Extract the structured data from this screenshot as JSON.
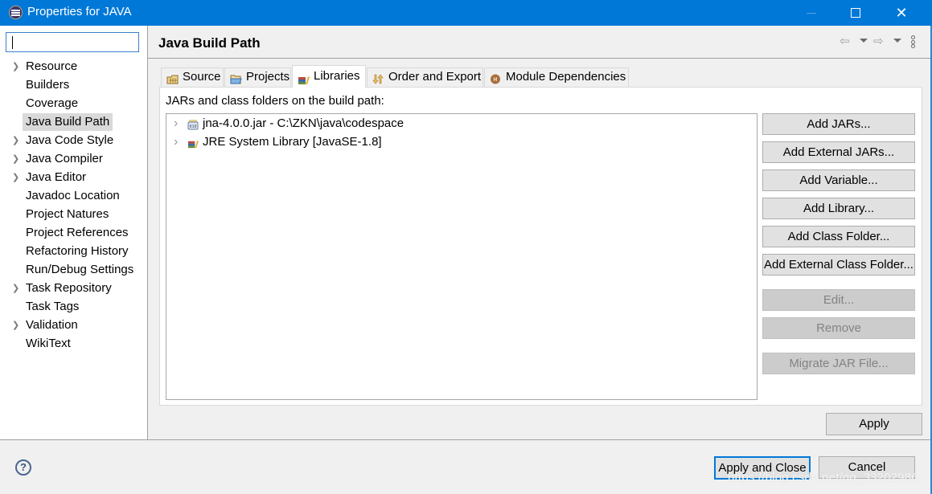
{
  "window": {
    "title": "Properties for JAVA",
    "controls": {
      "minimize": "minimize",
      "maximize": "maximize",
      "close": "✕"
    }
  },
  "sidebar": {
    "filter": {
      "value": "",
      "placeholder": ""
    },
    "items": [
      {
        "label": "Resource",
        "expandable": true,
        "selected": false
      },
      {
        "label": "Builders",
        "expandable": false,
        "selected": false
      },
      {
        "label": "Coverage",
        "expandable": false,
        "selected": false
      },
      {
        "label": "Java Build Path",
        "expandable": false,
        "selected": true
      },
      {
        "label": "Java Code Style",
        "expandable": true,
        "selected": false
      },
      {
        "label": "Java Compiler",
        "expandable": true,
        "selected": false
      },
      {
        "label": "Java Editor",
        "expandable": true,
        "selected": false
      },
      {
        "label": "Javadoc Location",
        "expandable": false,
        "selected": false
      },
      {
        "label": "Project Natures",
        "expandable": false,
        "selected": false
      },
      {
        "label": "Project References",
        "expandable": false,
        "selected": false
      },
      {
        "label": "Refactoring History",
        "expandable": false,
        "selected": false
      },
      {
        "label": "Run/Debug Settings",
        "expandable": false,
        "selected": false
      },
      {
        "label": "Task Repository",
        "expandable": true,
        "selected": false
      },
      {
        "label": "Task Tags",
        "expandable": false,
        "selected": false
      },
      {
        "label": "Validation",
        "expandable": true,
        "selected": false
      },
      {
        "label": "WikiText",
        "expandable": false,
        "selected": false
      }
    ]
  },
  "page": {
    "title": "Java Build Path",
    "nav": {
      "back": "⇦",
      "forward": "⇨"
    },
    "tabs": [
      {
        "label": "Source",
        "icon": "source-folder-icon",
        "active": false
      },
      {
        "label": "Projects",
        "icon": "project-folder-icon",
        "active": false
      },
      {
        "label": "Libraries",
        "icon": "library-icon",
        "active": true
      },
      {
        "label": "Order and Export",
        "icon": "order-export-icon",
        "active": false
      },
      {
        "label": "Module Dependencies",
        "icon": "module-icon",
        "active": false
      }
    ],
    "libraries": {
      "label": "JARs and class folders on the build path:",
      "entries": [
        {
          "label": "jna-4.0.0.jar - C:\\ZKN\\java\\codespace",
          "icon": "jar-icon"
        },
        {
          "label": "JRE System Library [JavaSE-1.8]",
          "icon": "library-icon"
        }
      ],
      "buttons": [
        {
          "label": "Add JARs...",
          "enabled": true
        },
        {
          "label": "Add External JARs...",
          "enabled": true
        },
        {
          "label": "Add Variable...",
          "enabled": true
        },
        {
          "label": "Add Library...",
          "enabled": true
        },
        {
          "label": "Add Class Folder...",
          "enabled": true
        },
        {
          "label": "Add External Class Folder...",
          "enabled": true
        },
        {
          "label": "Edit...",
          "enabled": false
        },
        {
          "label": "Remove",
          "enabled": false
        },
        {
          "label": "Migrate JAR File...",
          "enabled": false
        }
      ]
    },
    "apply_label": "Apply"
  },
  "footer": {
    "help": "?",
    "apply_close_label": "Apply and Close",
    "cancel_label": "Cancel"
  },
  "watermark": "https://blog.csdn.net/qq_33202986"
}
